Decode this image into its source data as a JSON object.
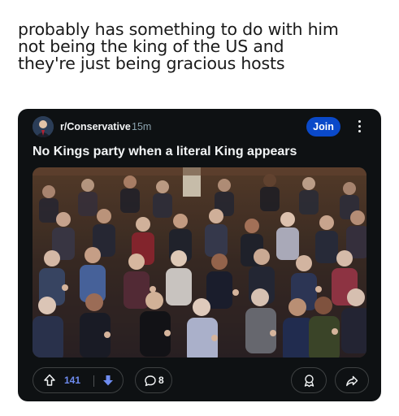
{
  "caption": {
    "line1": "probably has something to do with him",
    "line2": "not being the king of the US and",
    "line3": "they're just being gracious hosts"
  },
  "post": {
    "subreddit": "r/Conservative",
    "age": "15m",
    "join_label": "Join",
    "title": "No Kings party when a literal King appears",
    "upvotes": "141",
    "comments": "8"
  },
  "icons": {
    "avatar": "subreddit-avatar",
    "more": "three-dots-vertical-icon",
    "upvote": "arrow-up-icon",
    "downvote": "arrow-down-icon",
    "comment": "speech-bubble-icon",
    "award": "award-icon",
    "share": "share-arrow-icon"
  },
  "colors": {
    "card_bg": "#0e1113",
    "join_bg": "#0a49c9",
    "vote_accent": "#6e8cf0",
    "text": "#f2f4f5",
    "muted": "#8ba2ad"
  }
}
